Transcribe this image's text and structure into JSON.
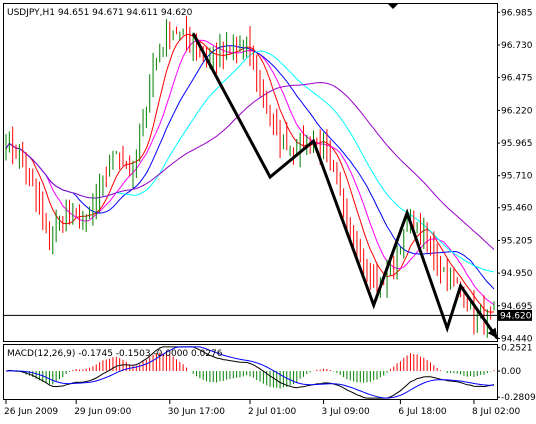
{
  "chart_data": [
    {
      "type": "candlestick",
      "header": "USDJPY,H1  94.651 94.671 94.611 94.620",
      "current_price_label": "94.620",
      "y_ticks": [
        "96.985",
        "96.730",
        "96.475",
        "96.220",
        "95.965",
        "95.710",
        "95.460",
        "95.205",
        "94.950",
        "94.695",
        "94.440"
      ],
      "ylim": [
        94.42,
        97.05
      ],
      "x_ticks": [
        {
          "label": "26 Jun 2009",
          "bar": 0
        },
        {
          "label": "29 Jun 09:00",
          "bar": 21
        },
        {
          "label": "30 Jun 17:00",
          "bar": 49
        },
        {
          "label": "2 Jul 01:00",
          "bar": 73
        },
        {
          "label": "3 Jul 09:00",
          "bar": 95
        },
        {
          "label": "6 Jul 18:00",
          "bar": 118
        },
        {
          "label": "8 Jul 02:00",
          "bar": 140
        }
      ],
      "bar_count": 147,
      "price_anchors": [
        [
          0,
          95.98
        ],
        [
          4,
          95.88
        ],
        [
          8,
          95.62
        ],
        [
          13,
          95.22
        ],
        [
          18,
          95.44
        ],
        [
          24,
          95.33
        ],
        [
          29,
          95.66
        ],
        [
          33,
          95.91
        ],
        [
          38,
          95.72
        ],
        [
          44,
          96.55
        ],
        [
          49,
          96.87
        ],
        [
          55,
          96.76
        ],
        [
          61,
          96.62
        ],
        [
          67,
          96.68
        ],
        [
          72,
          96.73
        ],
        [
          76,
          96.42
        ],
        [
          81,
          96.02
        ],
        [
          86,
          95.92
        ],
        [
          91,
          96.02
        ],
        [
          95,
          95.93
        ],
        [
          99,
          95.62
        ],
        [
          104,
          95.28
        ],
        [
          108,
          94.95
        ],
        [
          112,
          94.85
        ],
        [
          116,
          95.06
        ],
        [
          121,
          95.36
        ],
        [
          125,
          95.23
        ],
        [
          130,
          95.0
        ],
        [
          135,
          94.85
        ],
        [
          140,
          94.62
        ],
        [
          146,
          94.62
        ]
      ],
      "moving_averages": [
        {
          "color": "#ff0000",
          "period": 8
        },
        {
          "color": "#ff00ff",
          "period": 13
        },
        {
          "color": "#0000ff",
          "period": 21
        },
        {
          "color": "#00ffff",
          "period": 34
        },
        {
          "color": "#9900cc",
          "period": 55
        }
      ],
      "candle_colors": {
        "up": "#008000",
        "down": "#ff0000"
      },
      "annotation_path": [
        [
          96.82,
          95.7,
          95.98,
          94.7,
          95.42,
          94.52,
          94.85,
          94.44
        ]
      ],
      "annotation_path_bars": [
        56,
        79,
        92,
        110,
        120,
        132,
        136,
        147
      ]
    },
    {
      "type": "macd-histogram",
      "header": "MACD(12,26,9) -0.1745 -0.1503 -0.0000 0.0276",
      "y_ticks": [
        "0.2521",
        "0.00",
        "-0.2809"
      ],
      "ylim": [
        -0.3,
        0.28
      ],
      "histogram_colors": {
        "positive": "#ff0000",
        "negative": "#008000"
      },
      "line_colors": {
        "macd": "#000000",
        "signal": "#0000ff"
      }
    }
  ]
}
